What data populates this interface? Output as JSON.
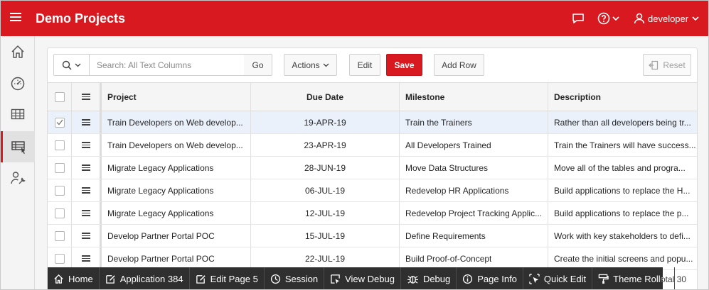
{
  "header": {
    "title": "Demo Projects",
    "user": "developer"
  },
  "sidebar": {
    "items": [
      {
        "icon": "home-icon"
      },
      {
        "icon": "dashboard-icon"
      },
      {
        "icon": "grid-icon"
      },
      {
        "icon": "table-edit-icon",
        "active": true
      },
      {
        "icon": "user-admin-icon"
      }
    ]
  },
  "toolbar": {
    "search_placeholder": "Search: All Text Columns",
    "go_label": "Go",
    "actions_label": "Actions",
    "edit_label": "Edit",
    "save_label": "Save",
    "add_row_label": "Add Row",
    "reset_label": "Reset"
  },
  "grid": {
    "columns": [
      "Project",
      "Due Date",
      "Milestone",
      "Description"
    ],
    "rows": [
      {
        "selected": true,
        "project": "Train Developers on Web develop...",
        "due": "19-APR-19",
        "milestone": "Train the Trainers",
        "description": "Rather than all developers being tr..."
      },
      {
        "selected": false,
        "project": "Train Developers on Web develop...",
        "due": "23-APR-19",
        "milestone": "All Developers Trained",
        "description": "Train the Trainers will have success..."
      },
      {
        "selected": false,
        "project": "Migrate Legacy Applications",
        "due": "28-JUN-19",
        "milestone": "Move Data Structures",
        "description": "Move all of the tables and progra..."
      },
      {
        "selected": false,
        "project": "Migrate Legacy Applications",
        "due": "06-JUL-19",
        "milestone": "Redevelop HR Applications",
        "description": "Build applications to replace the H..."
      },
      {
        "selected": false,
        "project": "Migrate Legacy Applications",
        "due": "12-JUL-19",
        "milestone": "Redevelop Project Tracking Applic...",
        "description": "Build applications to replace the p..."
      },
      {
        "selected": false,
        "project": "Develop Partner Portal POC",
        "due": "15-JUL-19",
        "milestone": "Define Requirements",
        "description": "Work with key stakeholders to defi..."
      },
      {
        "selected": false,
        "project": "Develop Partner Portal POC",
        "due": "22-JUL-19",
        "milestone": "Build Proof-of-Concept",
        "description": "Create the initial screens and popu..."
      }
    ],
    "total_label": "otal 30"
  },
  "devbar": {
    "items": [
      "Home",
      "Application 384",
      "Edit Page 5",
      "Session",
      "View Debug",
      "Debug",
      "Page Info",
      "Quick Edit",
      "Theme Roller"
    ]
  },
  "colors": {
    "brand": "#d8191f",
    "devbar": "#2f2f2f"
  }
}
